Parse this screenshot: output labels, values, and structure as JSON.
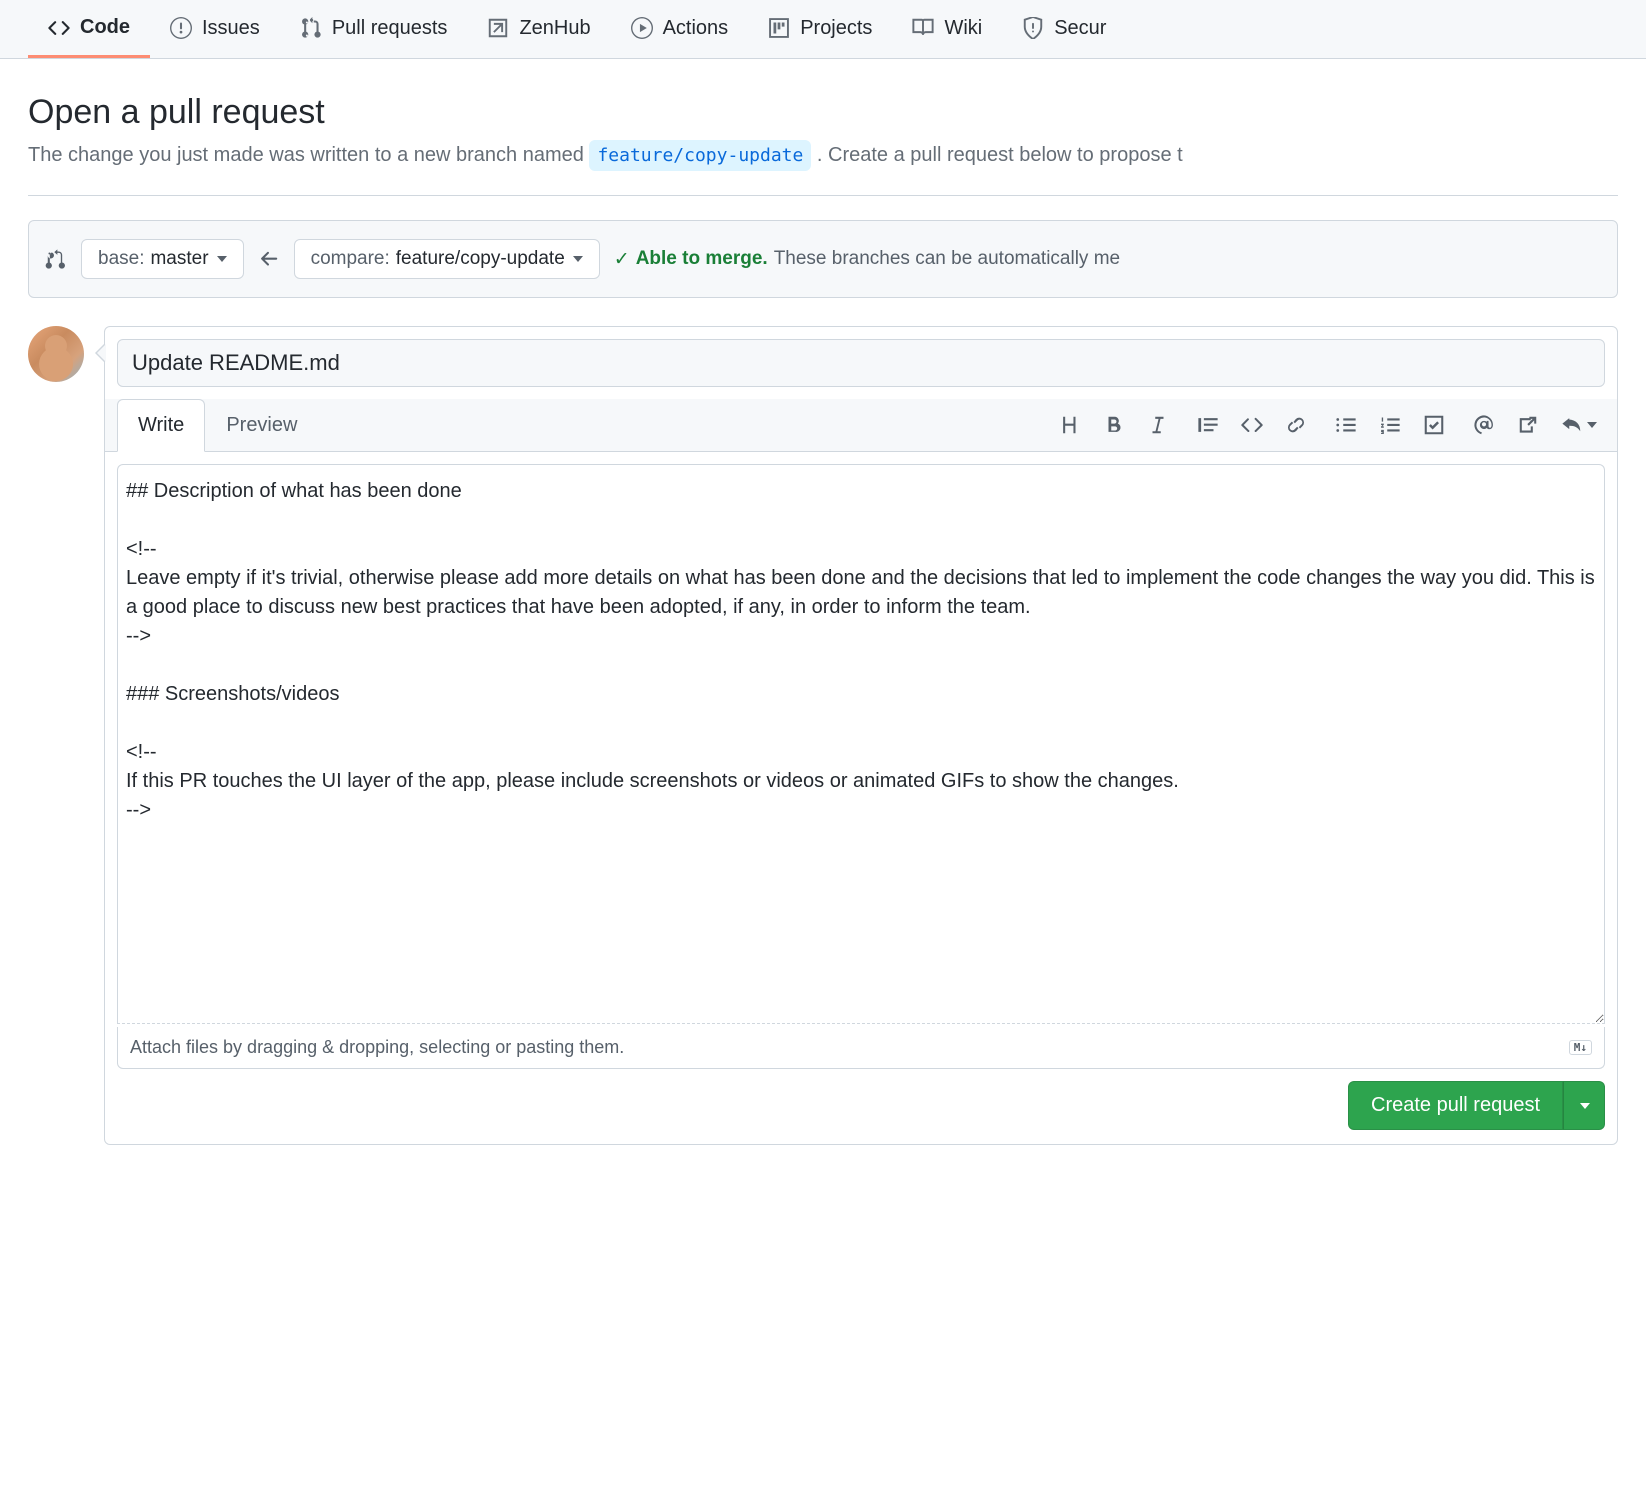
{
  "nav": {
    "items": [
      {
        "label": "Code",
        "icon": "code"
      },
      {
        "label": "Issues",
        "icon": "issue"
      },
      {
        "label": "Pull requests",
        "icon": "pr"
      },
      {
        "label": "ZenHub",
        "icon": "zenhub"
      },
      {
        "label": "Actions",
        "icon": "play"
      },
      {
        "label": "Projects",
        "icon": "project"
      },
      {
        "label": "Wiki",
        "icon": "book"
      },
      {
        "label": "Secur",
        "icon": "shield"
      }
    ],
    "active_index": 0
  },
  "header": {
    "title": "Open a pull request",
    "sub_prefix": "The change you just made was written to a new branch named ",
    "branch_name": "feature/copy-update",
    "sub_suffix": " . Create a pull request below to propose t"
  },
  "branches": {
    "base_label": "base: ",
    "base_value": "master",
    "compare_label": "compare: ",
    "compare_value": "feature/copy-update",
    "merge_able": "Able to merge.",
    "merge_detail": "These branches can be automatically me"
  },
  "pr": {
    "title_value": "Update README.md",
    "tabs": {
      "write": "Write",
      "preview": "Preview"
    },
    "body": "## Description of what has been done\n\n<!--\nLeave empty if it's trivial, otherwise please add more details on what has been done and the decisions that led to implement the code changes the way you did. This is a good place to discuss new best practices that have been adopted, if any, in order to inform the team.\n-->\n\n### Screenshots/videos\n\n<!--\nIf this PR touches the UI layer of the app, please include screenshots or videos or animated GIFs to show the changes.\n-->",
    "attach_hint": "Attach files by dragging & dropping, selecting or pasting them.",
    "markdown_badge": "M↓",
    "submit_label": "Create pull request"
  }
}
